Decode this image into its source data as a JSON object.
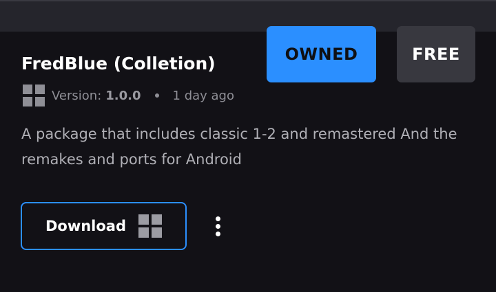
{
  "package": {
    "title": "FredBlue (Colletion)",
    "version_label": "Version:",
    "version_value": "1.0.0",
    "updated": "1 day ago",
    "description": "A package that includes classic 1-2 and remastered And the remakes and ports for Android"
  },
  "badges": {
    "owned": "OWNED",
    "free": "FREE"
  },
  "actions": {
    "download_label": "Download",
    "more_icon": "more-vertical-icon",
    "platform_icon": "windows-icon"
  },
  "colors": {
    "accent": "#2b8fff",
    "background": "#121116",
    "secondary_badge": "#38383f"
  }
}
